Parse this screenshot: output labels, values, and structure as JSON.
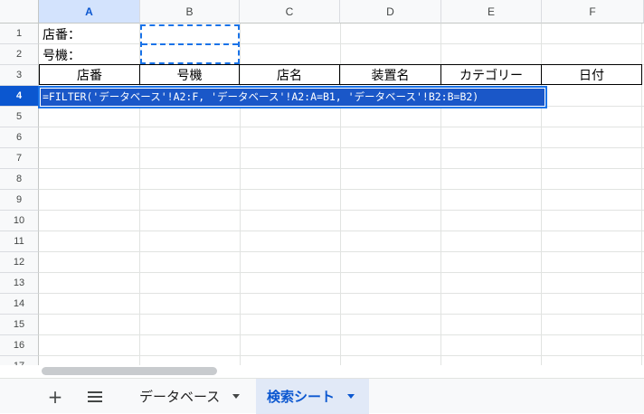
{
  "columns": [
    "A",
    "B",
    "C",
    "D",
    "E",
    "F"
  ],
  "rows": [
    "1",
    "2",
    "3",
    "4",
    "5",
    "6",
    "7",
    "8",
    "9",
    "10",
    "11",
    "12",
    "13",
    "14",
    "15",
    "16",
    "17"
  ],
  "cells": {
    "a1": "店番：",
    "a2": "号機："
  },
  "header_row": [
    "店番",
    "号機",
    "店名",
    "装置名",
    "カテゴリー",
    "日付"
  ],
  "editor": {
    "formula": "=FILTER('データベース'!A2:F, 'データベース'!A2:A=B1, 'データベース'!B2:B=B2)"
  },
  "tabs": {
    "add": "+",
    "sheets": [
      {
        "label": "データベース",
        "active": false
      },
      {
        "label": "検索シート",
        "active": true
      }
    ]
  },
  "colors": {
    "selection": "#0b57d0",
    "active_tab_bg": "#e1e9f7",
    "copy_border": "#1a73e8"
  }
}
